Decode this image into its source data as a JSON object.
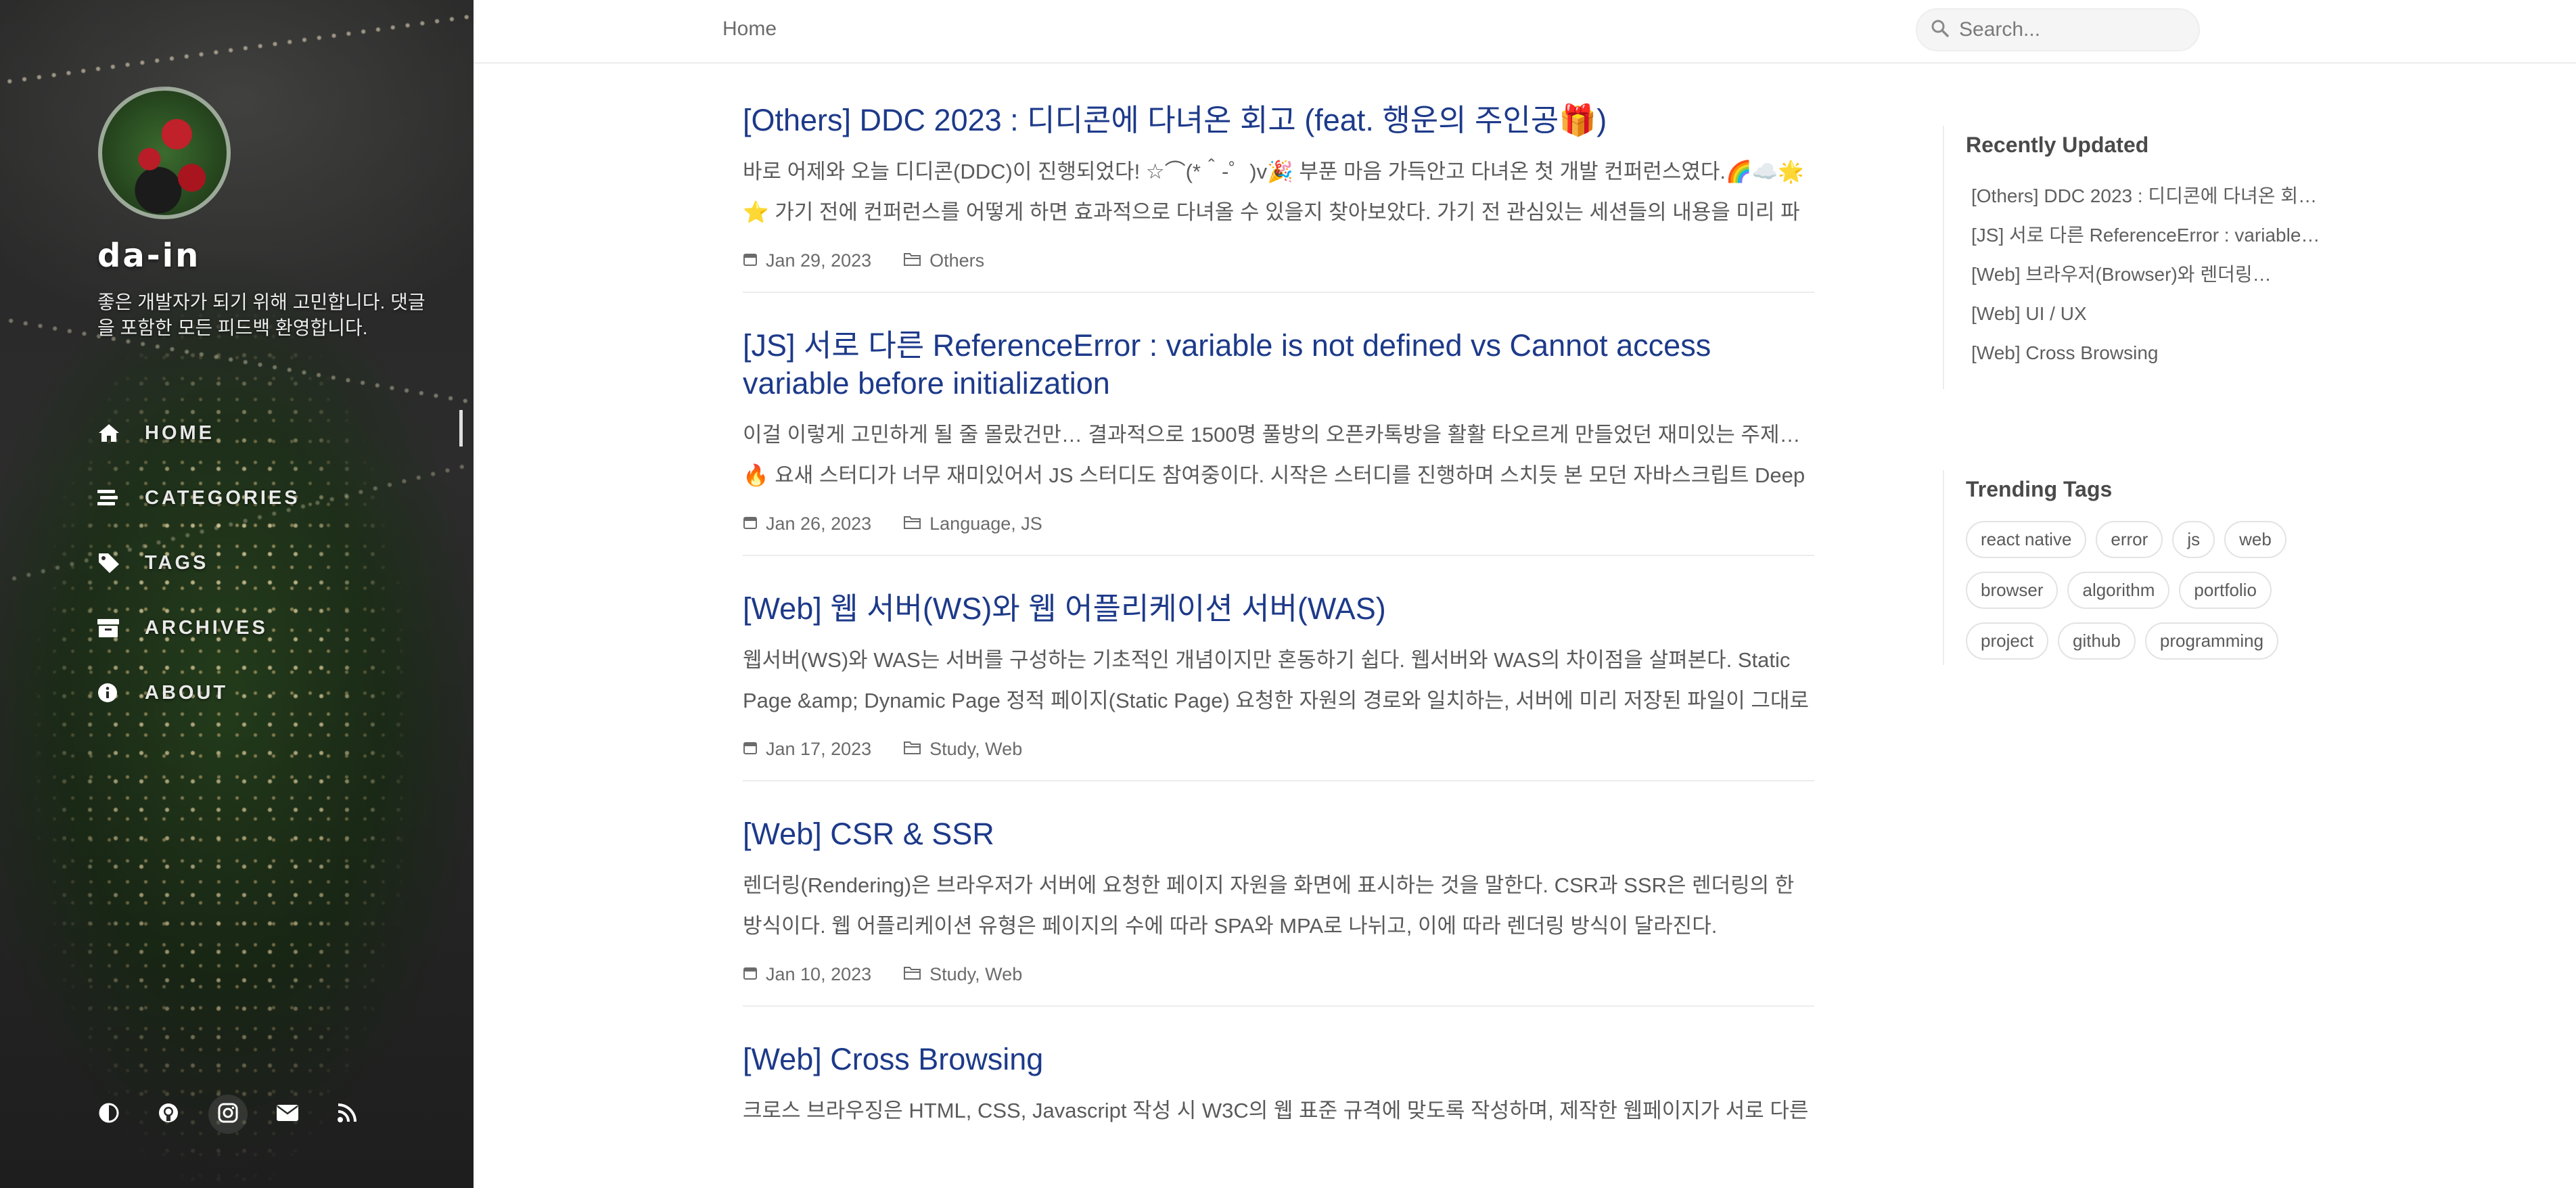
{
  "sidebar": {
    "title": "da-in",
    "subtitle": "좋은 개발자가 되기 위해 고민합니다. 댓글을 포함한 모든 피드백 환영합니다.",
    "nav": [
      {
        "label": "HOME",
        "icon": "home-icon",
        "active": true
      },
      {
        "label": "CATEGORIES",
        "icon": "stream-icon"
      },
      {
        "label": "TAGS",
        "icon": "tag-icon"
      },
      {
        "label": "ARCHIVES",
        "icon": "archive-icon"
      },
      {
        "label": "ABOUT",
        "icon": "info-icon"
      }
    ],
    "footer_icons": [
      "theme-toggle-icon",
      "github-icon",
      "instagram-icon",
      "email-icon",
      "rss-icon"
    ]
  },
  "topbar": {
    "breadcrumb": "Home",
    "search_placeholder": "Search..."
  },
  "posts": [
    {
      "title": "[Others] DDC 2023 : 디디콘에 다녀온 회고 (feat. 행운의 주인공🎁)",
      "excerpt": "바로 어제와 오늘 디디콘(DDC)이 진행되었다! ☆⌒(*＾-゜)v🎉 부푼 마음 가득안고 다녀온 첫 개발 컨퍼런스였다.🌈☁️🌟⭐ 가기 전에 컨퍼런스를 어떻게 하면 효과적으로 다녀올 수 있을지 찾아보았다. 가기 전 관심있는 세션들의 내용을 미리 파악해 두…",
      "date": "Jan 29, 2023",
      "category": "Others"
    },
    {
      "title": "[JS] 서로 다른 ReferenceError : variable is not defined vs Cannot access variable before initialization",
      "excerpt": "이걸 이렇게 고민하게 될 줄 몰랐건만… 결과적으로 1500명 풀방의 오픈카톡방을 활활 타오르게 만들었던 재미있는 주제…🔥 요새 스터디가 너무 재미있어서 JS 스터디도 참여중이다. 시작은 스터디를 진행하며 스치듯 본 모던 자바스크립트 Deep Div…",
      "date": "Jan 26, 2023",
      "category": "Language, JS"
    },
    {
      "title": "[Web] 웹 서버(WS)와 웹 어플리케이션 서버(WAS)",
      "excerpt": "웹서버(WS)와 WAS는 서버를 구성하는 기초적인 개념이지만 혼동하기 쉽다. 웹서버와 WAS의 차이점을 살펴본다. Static Page &amp; Dynamic Page 정적 페이지(Static Page) 요청한 자원의 경로와 일치하는, 서버에 미리 저장된 파일이 그대로 전달되…",
      "date": "Jan 17, 2023",
      "category": "Study, Web"
    },
    {
      "title": "[Web] CSR & SSR",
      "excerpt": "렌더링(Rendering)은 브라우저가 서버에 요청한 페이지 자원을 화면에 표시하는 것을 말한다. CSR과 SSR은 렌더링의 한 방식이다. 웹 어플리케이션 유형은 페이지의 수에 따라 SPA와 MPA로 나뉘고, 이에 따라 렌더링 방식이 달라진다. MPA(Multiple…",
      "date": "Jan 10, 2023",
      "category": "Study, Web"
    },
    {
      "title": "[Web] Cross Browsing",
      "excerpt": "크로스 브라우징은 HTML, CSS, Javascript 작성 시 W3C의 웹 표준 규격에 맞도록 작성하며, 제작한 웹페이지가 서로 다른 환",
      "date": "",
      "category": ""
    }
  ],
  "panel": {
    "recent_heading": "Recently Updated",
    "recent": [
      "[Others] DDC 2023 : 디디콘에 다녀온 회고…",
      "[JS] 서로 다른 ReferenceError : variable is…",
      "[Web] 브라우저(Browser)와 렌더링…",
      "[Web] UI / UX",
      "[Web] Cross Browsing"
    ],
    "tags_heading": "Trending Tags",
    "tags": [
      "react native",
      "error",
      "js",
      "web",
      "browser",
      "algorithm",
      "portfolio",
      "project",
      "github",
      "programming"
    ]
  },
  "colors": {
    "link": "#1d3a8a",
    "text": "#5a5a5a",
    "sidebar_text": "#ffffff",
    "divider": "#ececec"
  }
}
